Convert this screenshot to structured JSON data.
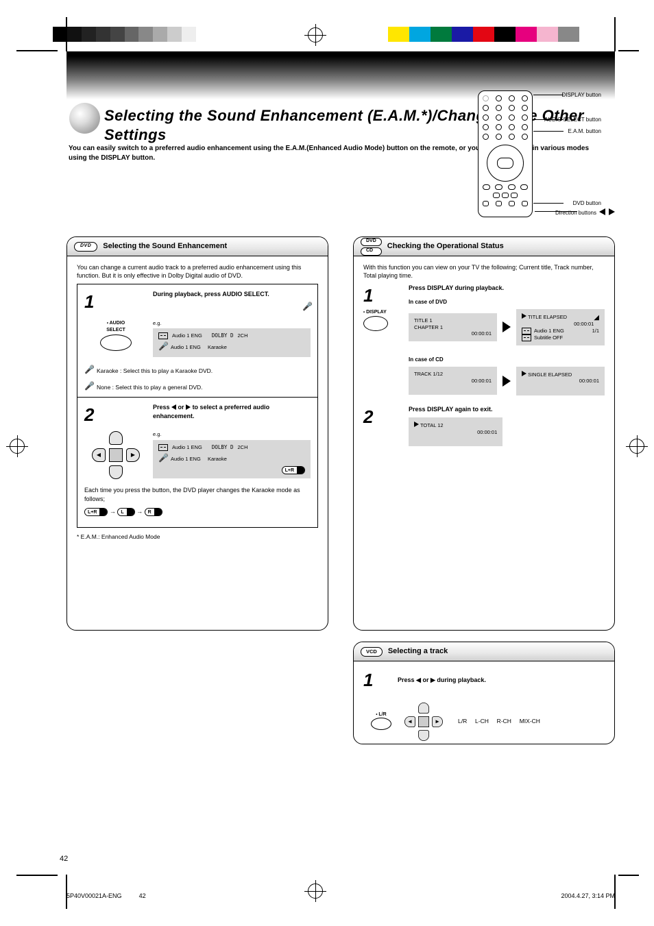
{
  "page_title": "Selecting the Sound Enhancement (E.A.M.*)/Changing the Other Settings",
  "intro": "You can easily switch to a preferred audio enhancement using the E.A.M.(Enhanced Audio Mode) button on the remote, or you can play a disc in various modes using the DISPLAY button.",
  "remote_labels": {
    "l1": "DISPLAY button",
    "l2": "AUDIO SELECT button",
    "l3": "E.A.M. button",
    "l4": "DVD button",
    "l5": "Direction buttons"
  },
  "left": {
    "badge": "DVD",
    "head_title": "Selecting the Sound Enhancement",
    "para_intro": "You can change a current audio track to a preferred audio enhancement using this function. But it is only effective in Dolby Digital audio of DVD.",
    "step1_n": "1",
    "step1_title": "During playback, press AUDIO SELECT.",
    "step1_side": "e.g.",
    "step1a": "Audio   1 ENG",
    "step1b": "Audio   1 ENG",
    "note_line1": "Karaoke                      : Select this to play a Karaoke DVD.",
    "note_line2": "None                          : Select this to play a general DVD.",
    "step2_n": "2",
    "step2_title": "Press ◀ or ▶ to select a preferred audio enhancement.",
    "step2_side": "e.g.",
    "step2a": "Audio   1 ENG",
    "step2b": "Audio   1 ENG",
    "step2c": "L+R",
    "footer_para": "Each time you press the button, the DVD player changes the Karaoke mode as follows;",
    "footer_seq": "L+R → L → R",
    "asterisk": "* E.A.M.: Enhanced Audio Mode"
  },
  "right_top": {
    "badge1": "DVD",
    "badge2": "CD",
    "head_title": "Checking the Operational Status",
    "intro": "With this function you can view on your TV the following; Current title, Track number, Total playing time.",
    "step1_n": "1",
    "step1_title": "Press DISPLAY during playback.",
    "btn_label": "DISPLAY",
    "dvd_sub": "In case of DVD",
    "panelA": {
      "t": "TITLE  1",
      "c": "CHAPTER   1",
      "time": "00:00:01"
    },
    "panelB": {
      "t": "TITLE ELAPSED",
      "sub": "Audio 1 ENG",
      "sub2": "Subtitle OFF",
      "time": "00:00:01",
      "extra": "1/1"
    },
    "cd_sub": "In case of CD",
    "panelC_l": {
      "t": "TRACK 1/12",
      "time": "00:00:01"
    },
    "panelC_r": {
      "t": "SINGLE ELAPSED",
      "time": "00:00:01"
    },
    "step2_n": "2",
    "step2_title": "Press DISPLAY again to exit.",
    "panelD": {
      "total": "TOTAL   12",
      "time": "00:00:01"
    }
  },
  "right_bot": {
    "badge": "VCD",
    "head_title": "Selecting a track",
    "step_n": "1",
    "step_title": "Press ◀ or ▶ during playback.",
    "oval_label": "L/R",
    "seq": "L/R       L-CH       R-CH       MIX-CH"
  },
  "page_number": "42",
  "footer_file": "5P40V00021A-ENG",
  "footer_ts": "2004.4.27, 3:14 PM",
  "footer_page": "42"
}
